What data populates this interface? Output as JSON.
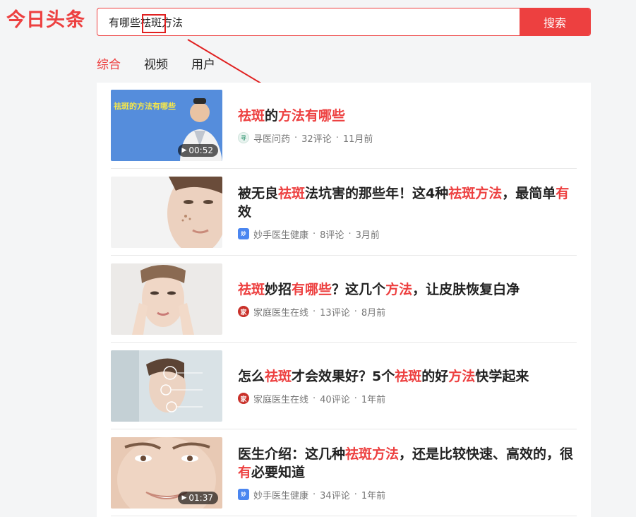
{
  "header": {
    "logo": "今日头条",
    "search_value": "有哪些祛斑方法",
    "search_button": "搜索"
  },
  "tabs": [
    {
      "label": "综合",
      "active": true
    },
    {
      "label": "视频",
      "active": false
    },
    {
      "label": "用户",
      "active": false
    }
  ],
  "colors": {
    "accent": "#ed4040",
    "annotation": "#e02020"
  },
  "results": [
    {
      "title_parts": [
        [
          "祛斑",
          true
        ],
        [
          "的",
          false
        ],
        [
          "方法有哪些",
          true
        ]
      ],
      "source": "寻医问药",
      "source_icon": "xunyi-icon",
      "comments": "32评论",
      "time": "11月前",
      "duration": "00:52",
      "thumb_caption": "祛斑的方法有哪些"
    },
    {
      "title_parts": [
        [
          "被无良",
          false
        ],
        [
          "祛斑",
          true
        ],
        [
          "法坑害的那些年！这4种",
          false
        ],
        [
          "祛斑方法",
          true
        ],
        [
          "，最简单",
          false
        ],
        [
          "有",
          true
        ],
        [
          "效",
          false
        ]
      ],
      "source": "妙手医生健康",
      "source_icon": "miaoshou-icon",
      "comments": "8评论",
      "time": "3月前",
      "duration": "",
      "thumb_caption": ""
    },
    {
      "title_parts": [
        [
          "祛斑",
          true
        ],
        [
          "妙招",
          false
        ],
        [
          "有哪些",
          true
        ],
        [
          "？这几个",
          false
        ],
        [
          "方法",
          true
        ],
        [
          "，让皮肤恢复白净",
          false
        ]
      ],
      "source": "家庭医生在线",
      "source_icon": "jiating-icon",
      "comments": "13评论",
      "time": "8月前",
      "duration": "",
      "thumb_caption": ""
    },
    {
      "title_parts": [
        [
          "怎么",
          false
        ],
        [
          "祛斑",
          true
        ],
        [
          "才会效果好？5个",
          false
        ],
        [
          "祛斑",
          true
        ],
        [
          "的好",
          false
        ],
        [
          "方法",
          true
        ],
        [
          "快学起来",
          false
        ]
      ],
      "source": "家庭医生在线",
      "source_icon": "jiating-icon",
      "comments": "40评论",
      "time": "1年前",
      "duration": "",
      "thumb_caption": ""
    },
    {
      "title_parts": [
        [
          "医生介绍：这几种",
          false
        ],
        [
          "祛斑方法",
          true
        ],
        [
          "，还是比较快速、高效的，很",
          false
        ],
        [
          "有",
          true
        ],
        [
          "必要知道",
          false
        ]
      ],
      "source": "妙手医生健康",
      "source_icon": "miaoshou-icon",
      "comments": "34评论",
      "time": "1年前",
      "duration": "01:37",
      "thumb_caption": ""
    }
  ]
}
